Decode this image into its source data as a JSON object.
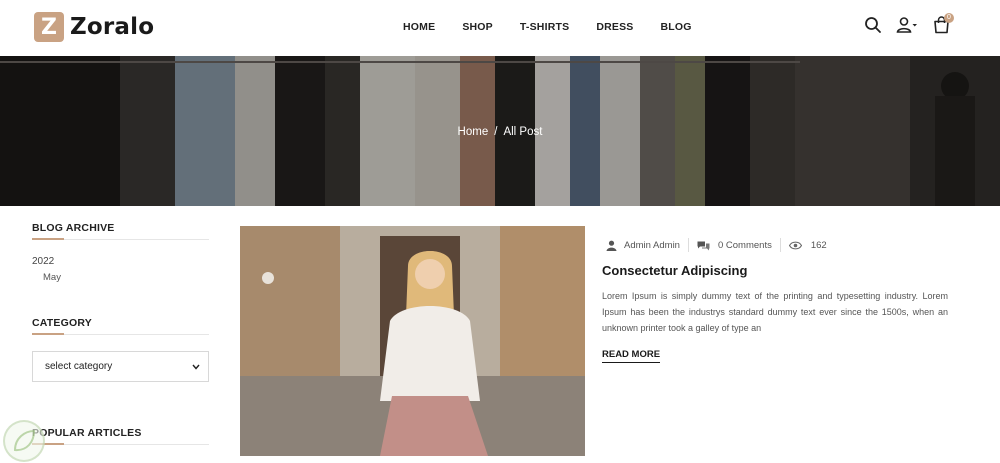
{
  "brand": {
    "logo_letter": "Z",
    "name": "Zoralo",
    "accent_color": "#c9a283"
  },
  "nav": {
    "items": [
      "HOME",
      "SHOP",
      "T-SHIRTS",
      "DRESS",
      "BLOG"
    ]
  },
  "header_icons": {
    "search": "search-icon",
    "account": "user-icon",
    "cart": "cart-icon",
    "cart_count": "0"
  },
  "breadcrumb": {
    "home": "Home",
    "separator": "/",
    "current": "All Post"
  },
  "sidebar": {
    "archive_title": "BLOG ARCHIVE",
    "archive_year": "2022",
    "archive_month": "May",
    "category_title": "CATEGORY",
    "category_select": "select category",
    "popular_title": "POPULAR ARTICLES"
  },
  "post": {
    "author": "Admin Admin",
    "comments": "0 Comments",
    "views": "162",
    "title": "Consectetur Adipiscing",
    "excerpt": "Lorem Ipsum is simply dummy text of the printing and typesetting industry. Lorem Ipsum has been the industrys standard dummy text ever since the 1500s, when an unknown printer took a galley of type an",
    "read_more": "READ MORE"
  }
}
